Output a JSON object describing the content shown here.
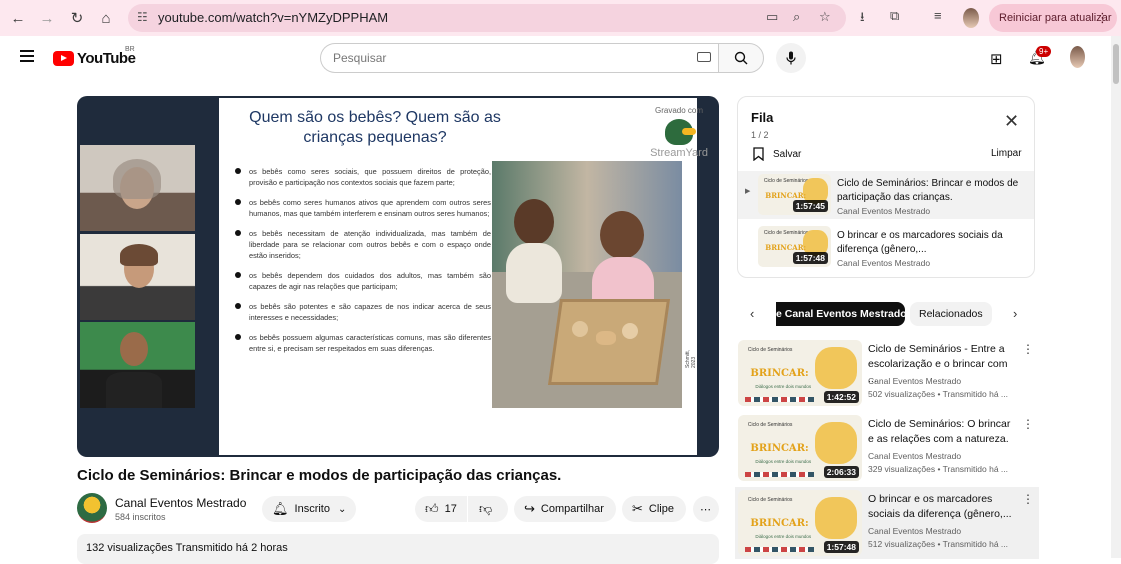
{
  "browser": {
    "url": "youtube.com/watch?v=nYMZyDPPHAM",
    "update_button": "Reiniciar para atualizar"
  },
  "header": {
    "logo_text": "YouTube",
    "region": "BR",
    "search_placeholder": "Pesquisar",
    "notification_count": "9+"
  },
  "slide": {
    "title": "Quem são os bebês? Quem são as crianças pequenas?",
    "bullets": [
      "os bebês como seres sociais, que possuem direitos de proteção, provisão e participação nos contextos sociais que fazem parte;",
      "os bebês como seres humanos ativos que aprendem com outros seres humanos, mas que também interferem e ensinam outros seres humanos;",
      "os bebês necessitam de atenção individualizada, mas também de liberdade para se relacionar com outros bebês e com o espaço onde estão inseridos;",
      "os bebês dependem dos cuidados dos adultos, mas também são capazes de agir nas relações que participam;",
      "os bebês são potentes e são capazes de nos indicar acerca de seus interesses e necessidades;",
      "os bebês possuem algumas características comuns, mas são diferentes entre si, e precisam ser respeitados em suas diferenças."
    ],
    "photo_credit": "Schmitt, 2023",
    "watermark_line": "Gravado com",
    "watermark_brand": "StreamYard"
  },
  "video": {
    "title": "Ciclo de Seminários: Brincar e modos de participação das crianças.",
    "channel": "Canal Eventos Mestrado",
    "subscribers": "584 inscritos",
    "subscribe_label": "Inscrito",
    "likes": "17",
    "share_label": "Compartilhar",
    "clip_label": "Clipe",
    "description_summary": "132 visualizações  Transmitido há 2 horas"
  },
  "queue": {
    "title": "Fila",
    "position": "1 / 2",
    "save_label": "Salvar",
    "clear_label": "Limpar",
    "items": [
      {
        "title": "Ciclo de Seminários: Brincar e modos de participação das crianças.",
        "channel": "Canal Eventos Mestrado",
        "duration": "1:57:45"
      },
      {
        "title": "O brincar e os marcadores sociais da diferença (gênero,...",
        "channel": "Canal Eventos Mestrado",
        "duration": "1:57:48"
      }
    ]
  },
  "thumbnail_text": {
    "series": "Ciclo de Seminários",
    "theme": "BRINCAR:",
    "subtitle": "Diálogos entre dois mundos"
  },
  "chips": {
    "selected": "e Canal Eventos Mestrado",
    "other": "Relacionados"
  },
  "recommendations": [
    {
      "title": "Ciclo de Seminários - Entre a escolarização e o brincar com ...",
      "channel": "Canal Eventos Mestrado",
      "meta": "502 visualizações  •  Transmitido há ...",
      "duration": "1:42:52"
    },
    {
      "title": "Ciclo de Seminários: O brincar e as relações com a natureza.",
      "channel": "Canal Eventos Mestrado",
      "meta": "329 visualizações  •  Transmitido há ...",
      "duration": "2:06:33"
    },
    {
      "title": "O brincar e os marcadores sociais da diferença (gênero,...",
      "channel": "Canal Eventos Mestrado",
      "meta": "512 visualizações  •  Transmitido há ...",
      "duration": "1:57:48"
    }
  ]
}
